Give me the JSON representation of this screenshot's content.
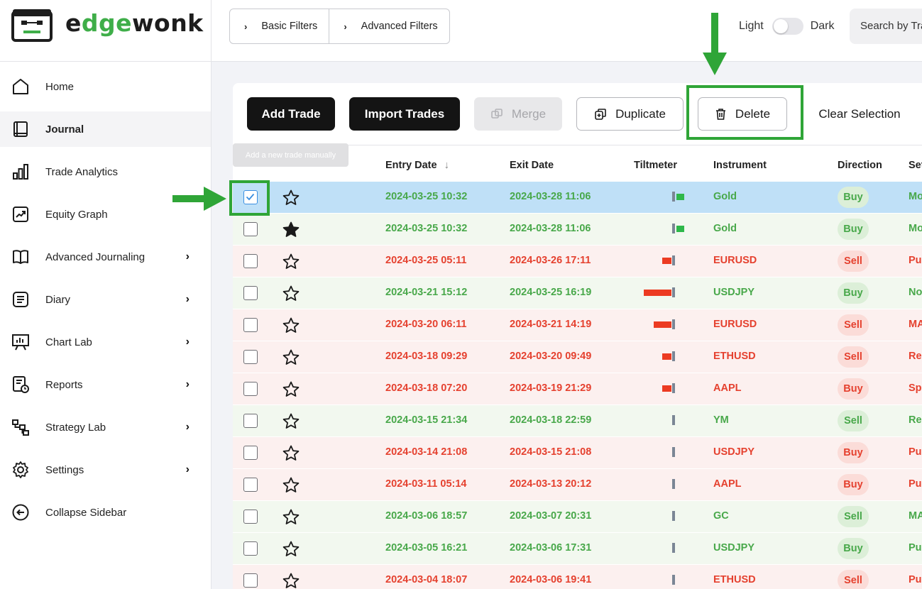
{
  "app": {
    "logo_text_pre": "e",
    "logo_text_g": "dge",
    "logo_text_post": "wonk",
    "logo_text_full": "edgewonk"
  },
  "sidebar": {
    "items": [
      {
        "label": "Home",
        "icon": "home-icon",
        "chevron": ""
      },
      {
        "label": "Journal",
        "icon": "journal-icon",
        "chevron": "",
        "active": true
      },
      {
        "label": "Trade Analytics",
        "icon": "bar-chart-icon",
        "chevron": ""
      },
      {
        "label": "Equity Graph",
        "icon": "trend-up-icon",
        "chevron": ""
      },
      {
        "label": "Advanced Journaling",
        "icon": "book-open-icon",
        "chevron": "›"
      },
      {
        "label": "Diary",
        "icon": "notes-icon",
        "chevron": "›"
      },
      {
        "label": "Chart Lab",
        "icon": "presentation-chart-icon",
        "chevron": "›"
      },
      {
        "label": "Reports",
        "icon": "report-clock-icon",
        "chevron": "›"
      },
      {
        "label": "Strategy Lab",
        "icon": "strategy-flow-icon",
        "chevron": "›"
      },
      {
        "label": "Settings",
        "icon": "gear-icon",
        "chevron": "›"
      },
      {
        "label": "Collapse Sidebar",
        "icon": "collapse-icon",
        "chevron": ""
      }
    ]
  },
  "topbar": {
    "basic_filters": "Basic Filters",
    "advanced_filters": "Advanced Filters",
    "theme_light": "Light",
    "theme_dark": "Dark",
    "search_placeholder": "Search by Tra"
  },
  "toolbar": {
    "add_trade": "Add Trade",
    "import_trades": "Import Trades",
    "merge": "Merge",
    "duplicate": "Duplicate",
    "delete": "Delete",
    "clear_selection": "Clear Selection",
    "tooltip": "Add a new trade manually"
  },
  "table": {
    "headers": {
      "entry_date": "Entry Date",
      "sort_indicator": "↓",
      "exit_date": "Exit Date",
      "tiltmeter": "Tiltmeter",
      "instrument": "Instrument",
      "direction": "Direction",
      "setup": "Set"
    },
    "rows": [
      {
        "entry": "2024-03-25 10:32",
        "exit": "2024-03-28 11:06",
        "instrument": "Gold",
        "direction": "Buy",
        "setup": "Mo",
        "result": "win",
        "starred": false,
        "checked": true,
        "selected": true,
        "tilt": 0.35
      },
      {
        "entry": "2024-03-25 10:32",
        "exit": "2024-03-28 11:06",
        "instrument": "Gold",
        "direction": "Buy",
        "setup": "Mo",
        "result": "win",
        "starred": true,
        "checked": false,
        "selected": false,
        "tilt": 0.35
      },
      {
        "entry": "2024-03-25 05:11",
        "exit": "2024-03-26 17:11",
        "instrument": "EURUSD",
        "direction": "Sell",
        "setup": "Pu",
        "result": "loss",
        "starred": false,
        "checked": false,
        "selected": false,
        "tilt": -0.45
      },
      {
        "entry": "2024-03-21 15:12",
        "exit": "2024-03-25 16:19",
        "instrument": "USDJPY",
        "direction": "Buy",
        "setup": "No",
        "result": "win",
        "starred": false,
        "checked": false,
        "selected": false,
        "tilt": -1.3
      },
      {
        "entry": "2024-03-20 06:11",
        "exit": "2024-03-21 14:19",
        "instrument": "EURUSD",
        "direction": "Sell",
        "setup": "MA",
        "result": "loss",
        "starred": false,
        "checked": false,
        "selected": false,
        "tilt": -0.85
      },
      {
        "entry": "2024-03-18 09:29",
        "exit": "2024-03-20 09:49",
        "instrument": "ETHUSD",
        "direction": "Sell",
        "setup": "Re",
        "result": "loss",
        "starred": false,
        "checked": false,
        "selected": false,
        "tilt": -0.45
      },
      {
        "entry": "2024-03-18 07:20",
        "exit": "2024-03-19 21:29",
        "instrument": "AAPL",
        "direction": "Buy",
        "setup": "Sp",
        "result": "loss",
        "starred": false,
        "checked": false,
        "selected": false,
        "tilt": -0.45
      },
      {
        "entry": "2024-03-15 21:34",
        "exit": "2024-03-18 22:59",
        "instrument": "YM",
        "direction": "Sell",
        "setup": "Re",
        "result": "win",
        "starred": false,
        "checked": false,
        "selected": false,
        "tilt": 0
      },
      {
        "entry": "2024-03-14 21:08",
        "exit": "2024-03-15 21:08",
        "instrument": "USDJPY",
        "direction": "Buy",
        "setup": "Pu",
        "result": "loss",
        "starred": false,
        "checked": false,
        "selected": false,
        "tilt": 0
      },
      {
        "entry": "2024-03-11 05:14",
        "exit": "2024-03-13 20:12",
        "instrument": "AAPL",
        "direction": "Buy",
        "setup": "Pu",
        "result": "loss",
        "starred": false,
        "checked": false,
        "selected": false,
        "tilt": 0
      },
      {
        "entry": "2024-03-06 18:57",
        "exit": "2024-03-07 20:31",
        "instrument": "GC",
        "direction": "Sell",
        "setup": "MA",
        "result": "win",
        "starred": false,
        "checked": false,
        "selected": false,
        "tilt": 0
      },
      {
        "entry": "2024-03-05 16:21",
        "exit": "2024-03-06 17:31",
        "instrument": "USDJPY",
        "direction": "Buy",
        "setup": "Pu",
        "result": "win",
        "starred": false,
        "checked": false,
        "selected": false,
        "tilt": 0
      },
      {
        "entry": "2024-03-04 18:07",
        "exit": "2024-03-06 19:41",
        "instrument": "ETHUSD",
        "direction": "Sell",
        "setup": "Pu",
        "result": "loss",
        "starred": false,
        "checked": false,
        "selected": false,
        "tilt": 0
      }
    ]
  },
  "colors": {
    "win_text": "#48a84a",
    "loss_text": "#e5412f",
    "brand_green": "#3fae49",
    "highlight_green": "#2fa537",
    "tilt_positive": "#2eb84a",
    "tilt_negative": "#ec3b22"
  }
}
